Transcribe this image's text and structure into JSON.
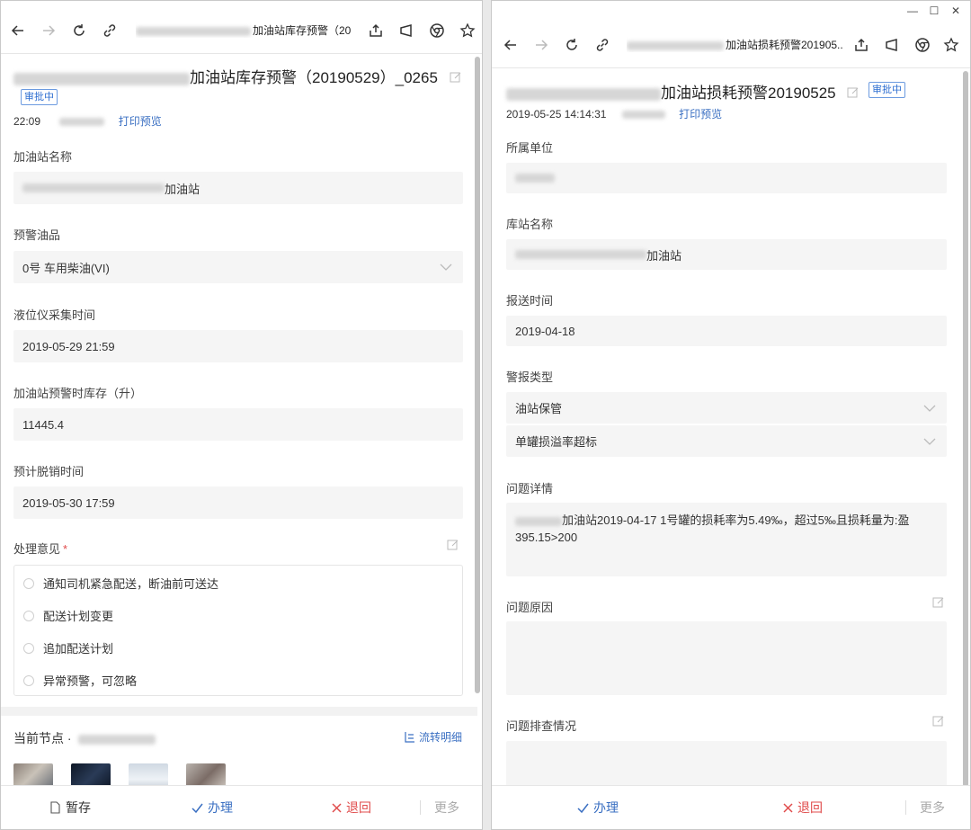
{
  "left": {
    "toolbar": {
      "title": "加油站库存预警（20..."
    },
    "header": {
      "title": "加油站库存预警（20190529）_0265",
      "status_badge": "审批中",
      "time": "22:09",
      "print_link": "打印预览"
    },
    "fields": [
      {
        "label": "加油站名称",
        "value": "加油站"
      },
      {
        "label": "预警油品",
        "value": "0号 车用柴油(VI)"
      },
      {
        "label": "液位仪采集时间",
        "value": "2019-05-29 21:59"
      },
      {
        "label": "加油站预警时库存（升）",
        "value": "11445.4"
      },
      {
        "label": "预计脱销时间",
        "value": "2019-05-30 17:59"
      }
    ],
    "opinion": {
      "label": "处理意见",
      "required_mark": "*",
      "options": [
        "通知司机紧急配送，断油前可送达",
        "配送计划变更",
        "追加配送计划",
        "异常预警，可忽略"
      ]
    },
    "node": {
      "label": "当前节点 ·",
      "flow_link": "流转明细"
    },
    "bottom": {
      "save": "暂存",
      "handle": "办理",
      "reject": "退回",
      "more": "更多"
    }
  },
  "right": {
    "toolbar": {
      "title": "加油站损耗预警201905..."
    },
    "header": {
      "title": "加油站损耗预警20190525",
      "status_badge": "审批中",
      "time": "2019-05-25 14:14:31",
      "print_link": "打印预览"
    },
    "fields": [
      {
        "label": "所属单位",
        "value": ""
      },
      {
        "label": "库站名称",
        "value": "加油站"
      },
      {
        "label": "报送时间",
        "value": "2019-04-18"
      }
    ],
    "alarm": {
      "label": "警报类型",
      "value1": "油站保管",
      "value2": "单罐损溢率超标"
    },
    "detail": {
      "label": "问题详情",
      "text": "加油站2019-04-17 1号罐的损耗率为5.49‰，超过5‰且损耗量为:盈395.15>200"
    },
    "cause": {
      "label": "问题原因"
    },
    "check": {
      "label": "问题排查情况"
    },
    "bottom": {
      "handle": "办理",
      "reject": "退回",
      "more": "更多"
    }
  },
  "colors": {
    "accent_blue": "#3a6fc2",
    "reject_red": "#e04b4b",
    "field_bg": "#f5f5f5"
  }
}
